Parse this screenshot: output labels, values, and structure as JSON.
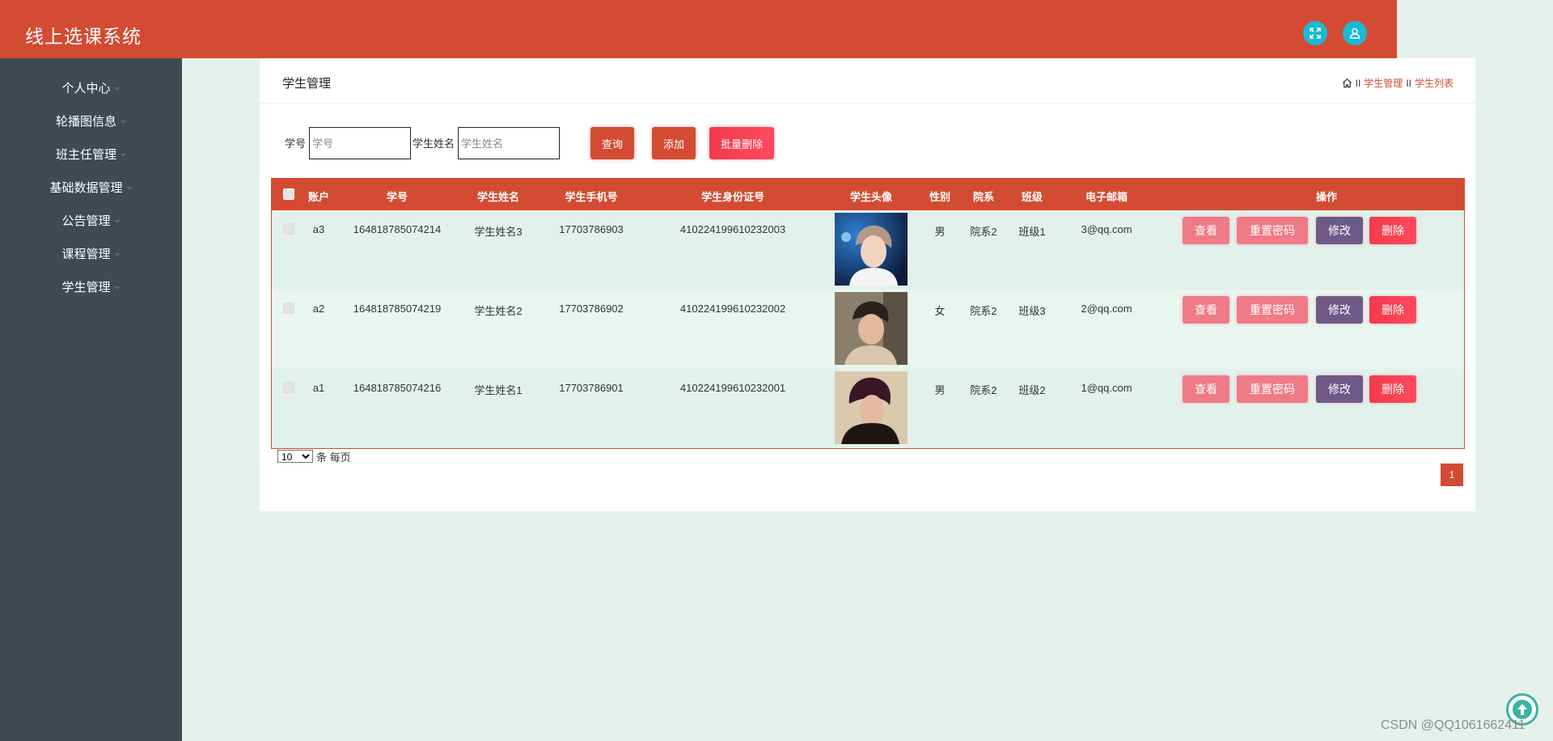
{
  "header": {
    "app_title": "线上选课系统",
    "fullscreen_icon": "fullscreen-icon",
    "user_icon": "user-icon"
  },
  "sidebar": {
    "items": [
      {
        "label": "个人中心"
      },
      {
        "label": "轮播图信息"
      },
      {
        "label": "班主任管理"
      },
      {
        "label": "基础数据管理"
      },
      {
        "label": "公告管理"
      },
      {
        "label": "课程管理"
      },
      {
        "label": "学生管理"
      }
    ]
  },
  "panel": {
    "title": "学生管理",
    "breadcrumb": {
      "separator": "II",
      "items": [
        "学生管理",
        "学生列表"
      ]
    }
  },
  "search": {
    "student_no_label": "学号",
    "student_no_placeholder": "学号",
    "student_name_label": "学生姓名",
    "student_name_placeholder": "学生姓名",
    "query_label": "查询",
    "add_label": "添加",
    "batch_delete_label": "批量删除"
  },
  "table": {
    "headers": [
      "账户",
      "学号",
      "学生姓名",
      "学生手机号",
      "学生身份证号",
      "学生头像",
      "性别",
      "院系",
      "班级",
      "电子邮箱",
      "操作"
    ],
    "rows": [
      {
        "account": "a3",
        "student_no": "164818785074214",
        "name": "学生姓名3",
        "phone": "17703786903",
        "id_card": "410224199610232003",
        "gender": "男",
        "department": "院系2",
        "class": "班级1",
        "email": "3@qq.com"
      },
      {
        "account": "a2",
        "student_no": "164818785074219",
        "name": "学生姓名2",
        "phone": "17703786902",
        "id_card": "410224199610232002",
        "gender": "女",
        "department": "院系2",
        "class": "班级3",
        "email": "2@qq.com"
      },
      {
        "account": "a1",
        "student_no": "164818785074216",
        "name": "学生姓名1",
        "phone": "17703786901",
        "id_card": "410224199610232001",
        "gender": "男",
        "department": "院系2",
        "class": "班级2",
        "email": "1@qq.com"
      }
    ],
    "actions": {
      "view": "查看",
      "reset_password": "重置密码",
      "edit": "修改",
      "delete": "删除"
    }
  },
  "pagination": {
    "page_size": "10",
    "page_size_suffix": "条 每页",
    "current_page": "1"
  },
  "watermark": "CSDN @QQ1061662411",
  "colors": {
    "primary": "#d44b33",
    "sidebar": "#3f4a53",
    "background": "#e5f2ec",
    "icon_circle": "#19b9d6",
    "row_odd": "#e3f1ec",
    "row_even": "#e9f5ef",
    "btn_pink": "#ee7b87",
    "btn_purple": "#6e5a87",
    "btn_red": "#f23a4c"
  }
}
